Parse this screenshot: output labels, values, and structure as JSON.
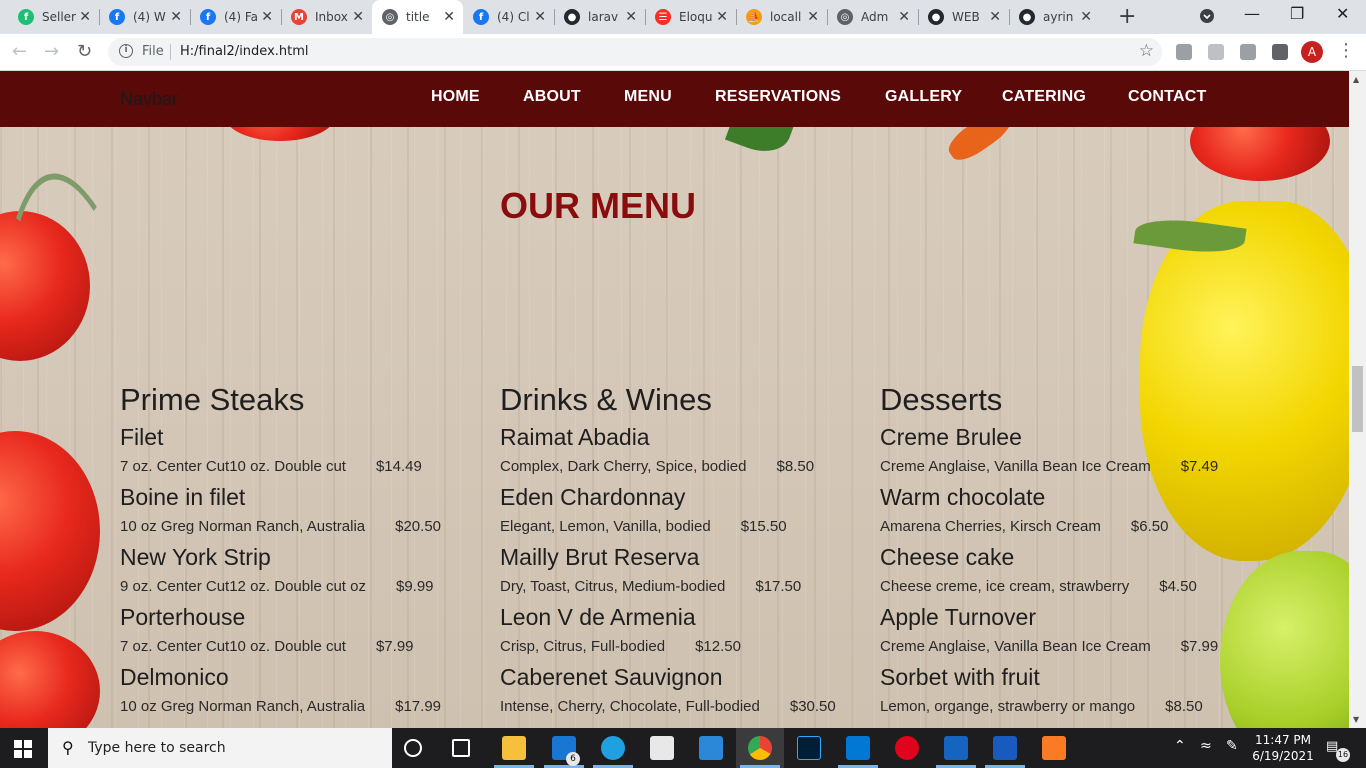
{
  "browser": {
    "tabs": [
      {
        "label": "Seller",
        "favicon": "fiverr-icon",
        "color": "#1dbf73"
      },
      {
        "label": "(4) W",
        "favicon": "facebook-icon",
        "color": "#1877f2"
      },
      {
        "label": "(4) Fa",
        "favicon": "facebook-icon",
        "color": "#1877f2"
      },
      {
        "label": "Inbox",
        "favicon": "gmail-icon",
        "color": "#ea4335"
      },
      {
        "label": "title",
        "favicon": "globe-icon",
        "color": "#5f6368",
        "active": true
      },
      {
        "label": "(4) Cl",
        "favicon": "facebook-icon",
        "color": "#1877f2"
      },
      {
        "label": "larav",
        "favicon": "github-icon",
        "color": "#24292e"
      },
      {
        "label": "Eloqu",
        "favicon": "laravel-icon",
        "color": "#ff2d20"
      },
      {
        "label": "locall",
        "favicon": "phpmyadmin-icon",
        "color": "#f89c0e"
      },
      {
        "label": "Adm",
        "favicon": "globe-icon",
        "color": "#5f6368"
      },
      {
        "label": "WEB",
        "favicon": "github-icon",
        "color": "#24292e"
      },
      {
        "label": "ayrin",
        "favicon": "github-icon",
        "color": "#24292e"
      }
    ],
    "address": {
      "scheme_label": "File",
      "url": "H:/final2/index.html"
    },
    "profile_initial": "A"
  },
  "site": {
    "brand": "Navbar",
    "nav": [
      "HOME",
      "ABOUT",
      "MENU",
      "RESERVATIONS",
      "GALLERY",
      "CATERING",
      "CONTACT"
    ],
    "menu_title": "OUR MENU",
    "colors": {
      "nav_bg": "#5a0909",
      "title": "#8a0d0d"
    },
    "columns": [
      {
        "title": "Prime Steaks",
        "items": [
          {
            "name": "Filet",
            "desc": "7 oz. Center Cut10 oz. Double cut",
            "price": "$14.49"
          },
          {
            "name": "Boine in filet",
            "desc": "10 oz Greg Norman Ranch, Australia",
            "price": "$20.50"
          },
          {
            "name": "New York Strip",
            "desc": "9 oz. Center Cut12 oz. Double cut oz",
            "price": "$9.99"
          },
          {
            "name": "Porterhouse",
            "desc": "7 oz. Center Cut10 oz. Double cut",
            "price": "$7.99"
          },
          {
            "name": "Delmonico",
            "desc": "10 oz Greg Norman Ranch, Australia",
            "price": "$17.99"
          }
        ]
      },
      {
        "title": "Drinks & Wines",
        "items": [
          {
            "name": "Raimat Abadia",
            "desc": "Complex, Dark Cherry, Spice, bodied",
            "price": "$8.50"
          },
          {
            "name": "Eden Chardonnay",
            "desc": "Elegant, Lemon, Vanilla, bodied",
            "price": "$15.50"
          },
          {
            "name": "Mailly Brut Reserva",
            "desc": "Dry, Toast, Citrus, Medium-bodied",
            "price": "$17.50"
          },
          {
            "name": "Leon V de Armenia",
            "desc": "Crisp, Citrus, Full-bodied",
            "price": "$12.50"
          },
          {
            "name": "Caberenet Sauvignon",
            "desc": "Intense, Cherry, Chocolate, Full-bodied",
            "price": "$30.50"
          }
        ]
      },
      {
        "title": "Desserts",
        "items": [
          {
            "name": "Creme Brulee",
            "desc": "Creme Anglaise, Vanilla Bean Ice Cream",
            "price": "$7.49"
          },
          {
            "name": "Warm chocolate",
            "desc": "Amarena Cherries, Kirsch Cream",
            "price": "$6.50"
          },
          {
            "name": "Cheese cake",
            "desc": "Cheese creme, ice cream, strawberry",
            "price": "$4.50"
          },
          {
            "name": "Apple Turnover",
            "desc": "Creme Anglaise, Vanilla Bean Ice Cream",
            "price": "$7.99"
          },
          {
            "name": "Sorbet with fruit",
            "desc": "Lemon, organge, strawberry or mango",
            "price": "$8.50"
          }
        ]
      }
    ]
  },
  "taskbar": {
    "search_placeholder": "Type here to search",
    "mail_badge": "6",
    "time": "11:47 PM",
    "date": "6/19/2021",
    "notification_count": "16",
    "apps": [
      "cortana-icon",
      "task-view-icon",
      "file-explorer-icon",
      "mail-icon",
      "edge-icon",
      "store-icon",
      "sticky-icon",
      "chrome-icon",
      "photoshop-icon",
      "vscode-icon",
      "opera-icon",
      "video-icon",
      "word-icon",
      "xampp-icon"
    ]
  }
}
